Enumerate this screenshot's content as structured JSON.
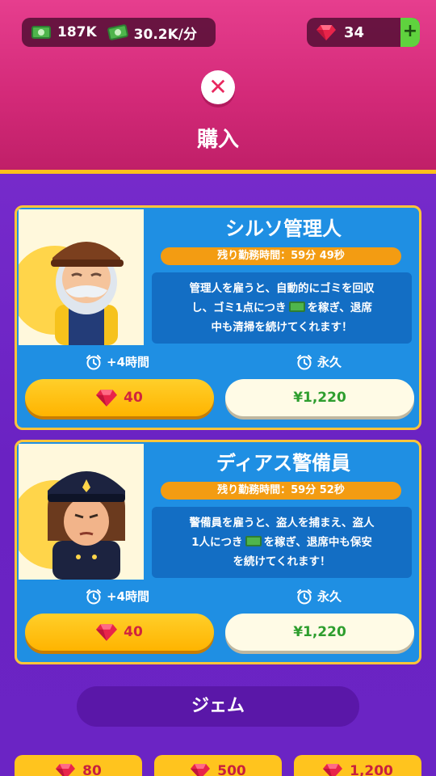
{
  "header": {
    "money": "187K",
    "income_rate": "30.2K/分",
    "gems": "34",
    "plus_label": "+",
    "close_label": "✕",
    "title": "購入"
  },
  "cards": [
    {
      "name": "シルソ管理人",
      "timer": "残り勤務時間：59分 49秒",
      "desc_line1": "管理人を雇うと、自動的にゴミを回収",
      "desc_line2a": "し、ゴミ1点につき",
      "desc_line2b": "を稼ぎ、退席",
      "desc_line3": "中も清掃を続けてくれます！",
      "left_duration": "+4時間",
      "right_duration": "永久",
      "gem_cost": "40",
      "price": "¥1,220"
    },
    {
      "name": "ディアス警備員",
      "timer": "残り勤務時間：59分 52秒",
      "desc_line1": "警備員を雇うと、盗人を捕まえ、盗人",
      "desc_line2a": "1人につき",
      "desc_line2b": "を稼ぎ、退席中も保安",
      "desc_line3": "を続けてくれます！",
      "left_duration": "+4時間",
      "right_duration": "永久",
      "gem_cost": "40",
      "price": "¥1,220"
    }
  ],
  "gem_section": {
    "title": "ジェム",
    "tiles": [
      "80",
      "500",
      "1,200"
    ]
  },
  "colors": {
    "header_pink": "#d42a79",
    "background_purple": "#6a22c2",
    "card_blue": "#1f8fe3",
    "accent_yellow": "#ffc43a",
    "price_green": "#2e9e2e",
    "gem_red": "#d0243e"
  },
  "icons": [
    "cash-icon",
    "cash-rate-icon",
    "gem-icon",
    "plus-icon",
    "close-icon",
    "alarm-clock-icon"
  ]
}
